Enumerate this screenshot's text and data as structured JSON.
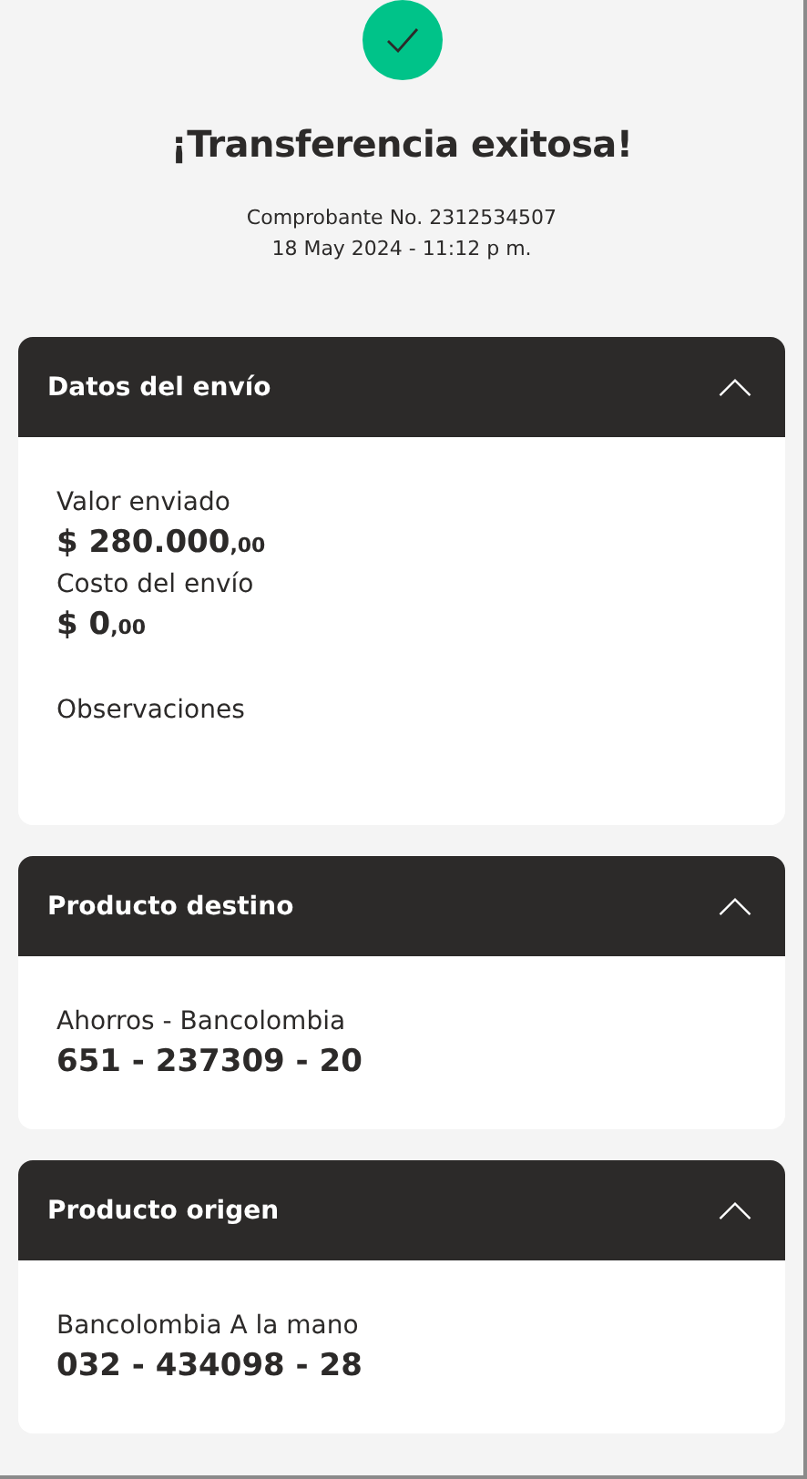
{
  "status": {
    "success": true,
    "title": "¡Transferencia exitosa!",
    "receipt": "Comprobante No. 2312534507",
    "datetime": "18 May 2024 - 11:12 p m."
  },
  "sections": [
    {
      "title": "Datos del envío",
      "expanded": true,
      "fields": [
        {
          "kind": "amount",
          "label": "Valor enviado",
          "value": "$ 280.000",
          "cents": ",00"
        },
        {
          "kind": "amount",
          "label": "Costo del envío",
          "value": "$ 0",
          "cents": ",00"
        },
        {
          "kind": "note",
          "label": "Observaciones"
        }
      ]
    },
    {
      "title": "Producto destino",
      "expanded": true,
      "fields": [
        {
          "kind": "account",
          "label": "Ahorros - Bancolombia",
          "value": "651 - 237309 - 20"
        }
      ]
    },
    {
      "title": "Producto origen",
      "expanded": true,
      "fields": [
        {
          "kind": "account",
          "label": "Bancolombia A la mano",
          "value": "032 - 434098 - 28"
        }
      ]
    }
  ]
}
